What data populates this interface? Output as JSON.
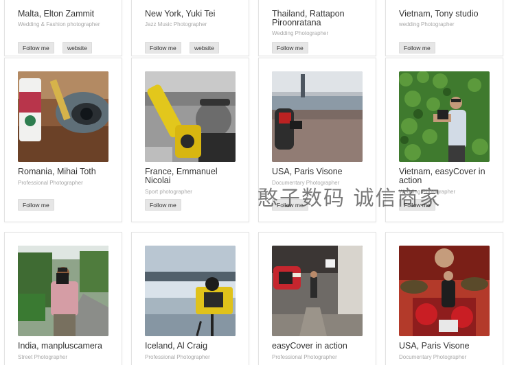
{
  "buttons": {
    "follow": "Follow me",
    "website": "website"
  },
  "row1": [
    {
      "name": "Malta, Elton Zammit",
      "role": "Wedding & Fashion photographer"
    },
    {
      "name": "New York, Yuki Tei",
      "role": "Jazz Music Photographer"
    },
    {
      "name": "Thailand, Rattapon Piroonratana",
      "role": "Wedding Photographer"
    },
    {
      "name": "Vietnam, Tony studio",
      "role": "wedding Photographer"
    }
  ],
  "row2": [
    {
      "name": "Romania, Mihai Toth",
      "role": "Professional Photographer"
    },
    {
      "name": "France, Emmanuel Nicolai",
      "role": "Sport photographer"
    },
    {
      "name": "USA, Paris Visone",
      "role": "Documentary Photographer"
    },
    {
      "name": "Vietnam, easyCover in action",
      "role": "Wedding Photographer"
    }
  ],
  "row3": [
    {
      "name": "India, manpluscamera",
      "role": "Street Photographer"
    },
    {
      "name": "Iceland, Al Craig",
      "role": "Professional Photographer"
    },
    {
      "name": "easyCover in action",
      "role": "Professional Photographer"
    },
    {
      "name": "USA, Paris Visone",
      "role": "Documentary Photographer"
    }
  ],
  "watermark": "憨子数码 诚信商家"
}
